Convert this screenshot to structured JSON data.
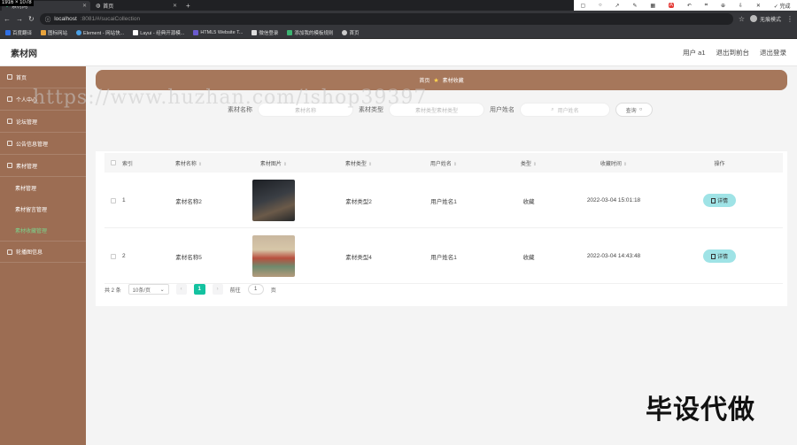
{
  "browser": {
    "dims": "1916 × 1078",
    "tabs": [
      {
        "label": "素材网",
        "active": true
      },
      {
        "label": "首页",
        "active": false
      }
    ],
    "new_tab": "+",
    "url_host": "localhost",
    "url_path": ":8081/#/sucaiCollection",
    "profile": "无痕模式",
    "ext_done": "完成",
    "bookmarks": [
      "百度翻译",
      "图标网站",
      "Element - 网站快...",
      "Layui - 经典开源模...",
      "HTML5 Website T...",
      "微信登录",
      "添加我的模板规则",
      "首页"
    ]
  },
  "header": {
    "logo": "素材网",
    "links": [
      "用户 a1",
      "退出到前台",
      "退出登录"
    ]
  },
  "sidebar": {
    "items": [
      {
        "label": "首页"
      },
      {
        "label": "个人中心"
      },
      {
        "label": "论坛管理"
      },
      {
        "label": "公告信息管理"
      },
      {
        "label": "素材管理"
      }
    ],
    "sub_items": [
      {
        "label": "素材管理",
        "active": false
      },
      {
        "label": "素材留言管理",
        "active": false
      },
      {
        "label": "素材收藏管理",
        "active": true
      }
    ],
    "last_item": "轮播图信息"
  },
  "breadcrumb": {
    "home": "首页",
    "current": "素材收藏"
  },
  "filters": {
    "name_label": "素材名称",
    "name_placeholder": "素材名称",
    "type_label": "素材类型",
    "type_placeholder": "素材类型素材类型",
    "user_label": "用户姓名",
    "user_placeholder": "用户姓名",
    "search_label": "查询"
  },
  "table": {
    "headers": [
      "索引",
      "素材名称",
      "素材图片",
      "素材类型",
      "用户姓名",
      "类型",
      "收藏时间",
      "操作"
    ],
    "rows": [
      {
        "index": "1",
        "name": "素材名称2",
        "type": "素材类型2",
        "user": "用户姓名1",
        "kind": "收藏",
        "time": "2022-03-04 15:01:18",
        "action": "详情"
      },
      {
        "index": "2",
        "name": "素材名称5",
        "type": "素材类型4",
        "user": "用户姓名1",
        "kind": "收藏",
        "time": "2022-03-04 14:43:48",
        "action": "详情"
      }
    ]
  },
  "pager": {
    "total": "共 2 条",
    "size": "10条/页",
    "page": "1",
    "goto": "前往",
    "goto_value": "1",
    "page_unit": "页"
  },
  "watermark": "https://www.huzhan.com/ishop39397",
  "overlay": "毕设代做"
}
